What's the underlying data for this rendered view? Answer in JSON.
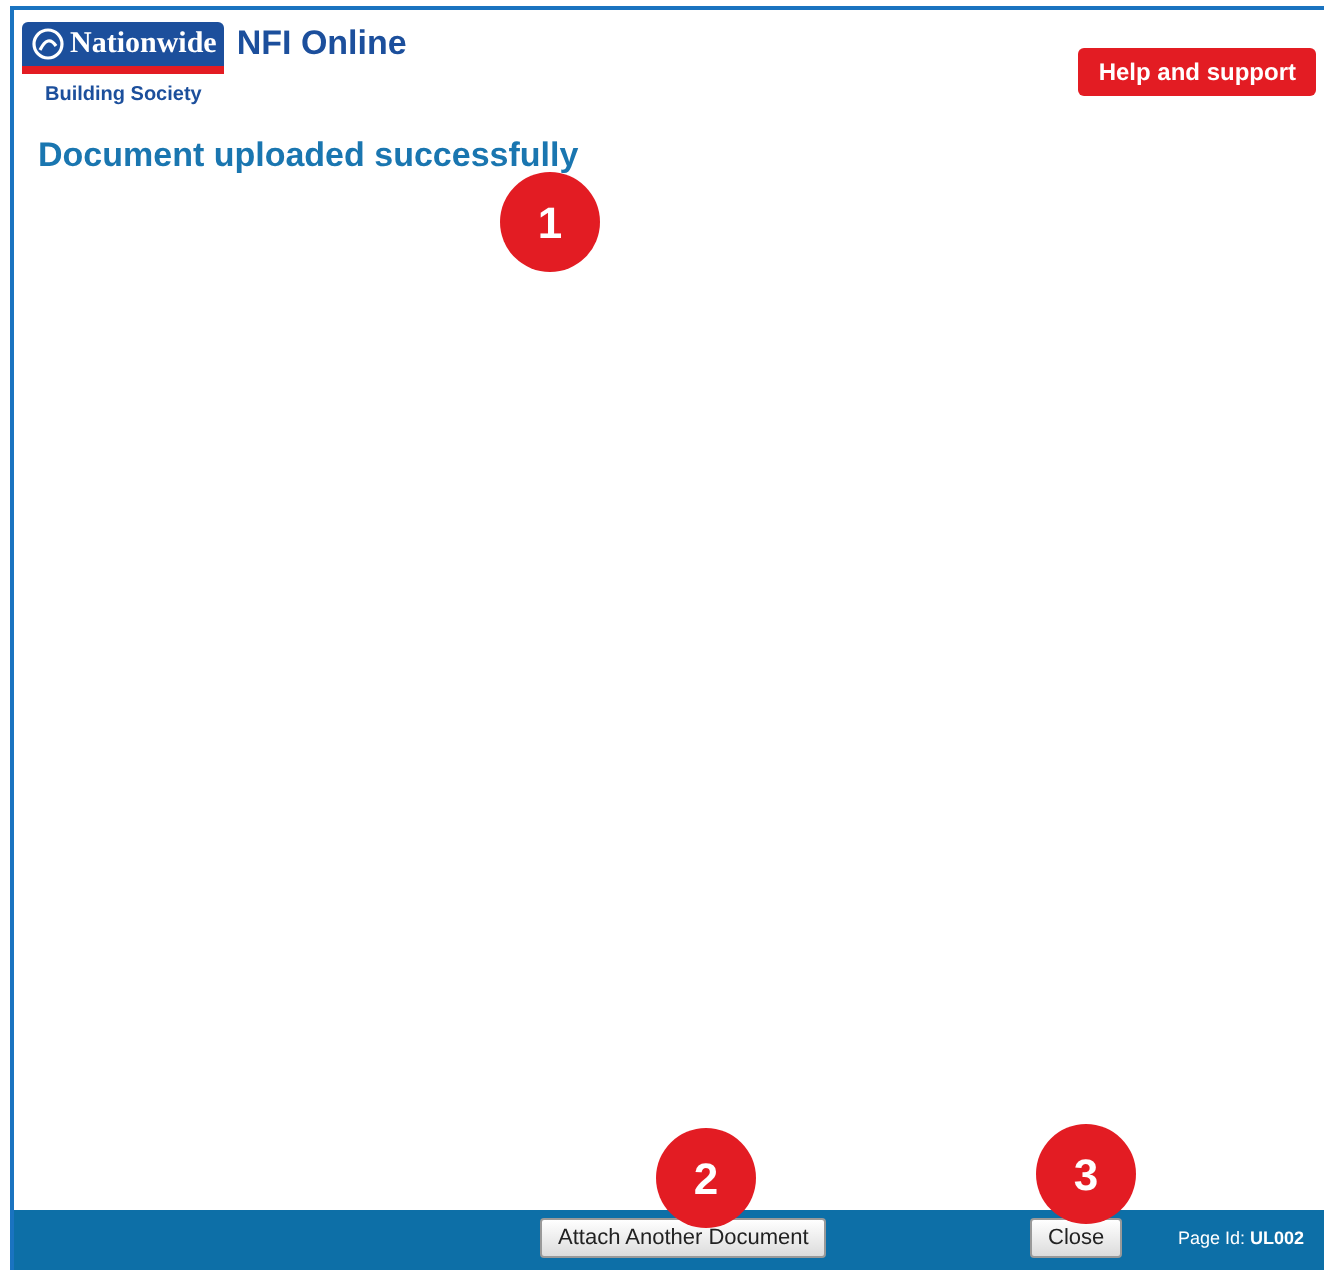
{
  "header": {
    "brand": "Nationwide",
    "brand_subtitle": "Building Society",
    "app_title": "NFI Online",
    "help_button": "Help and support"
  },
  "page": {
    "heading": "Document uploaded successfully"
  },
  "footer": {
    "buttons": [
      "Attach Another Document",
      "Close"
    ],
    "page_id": "Page Id: **UL002**"
  },
  "callouts": [
    "1",
    "2",
    "3"
  ]
}
